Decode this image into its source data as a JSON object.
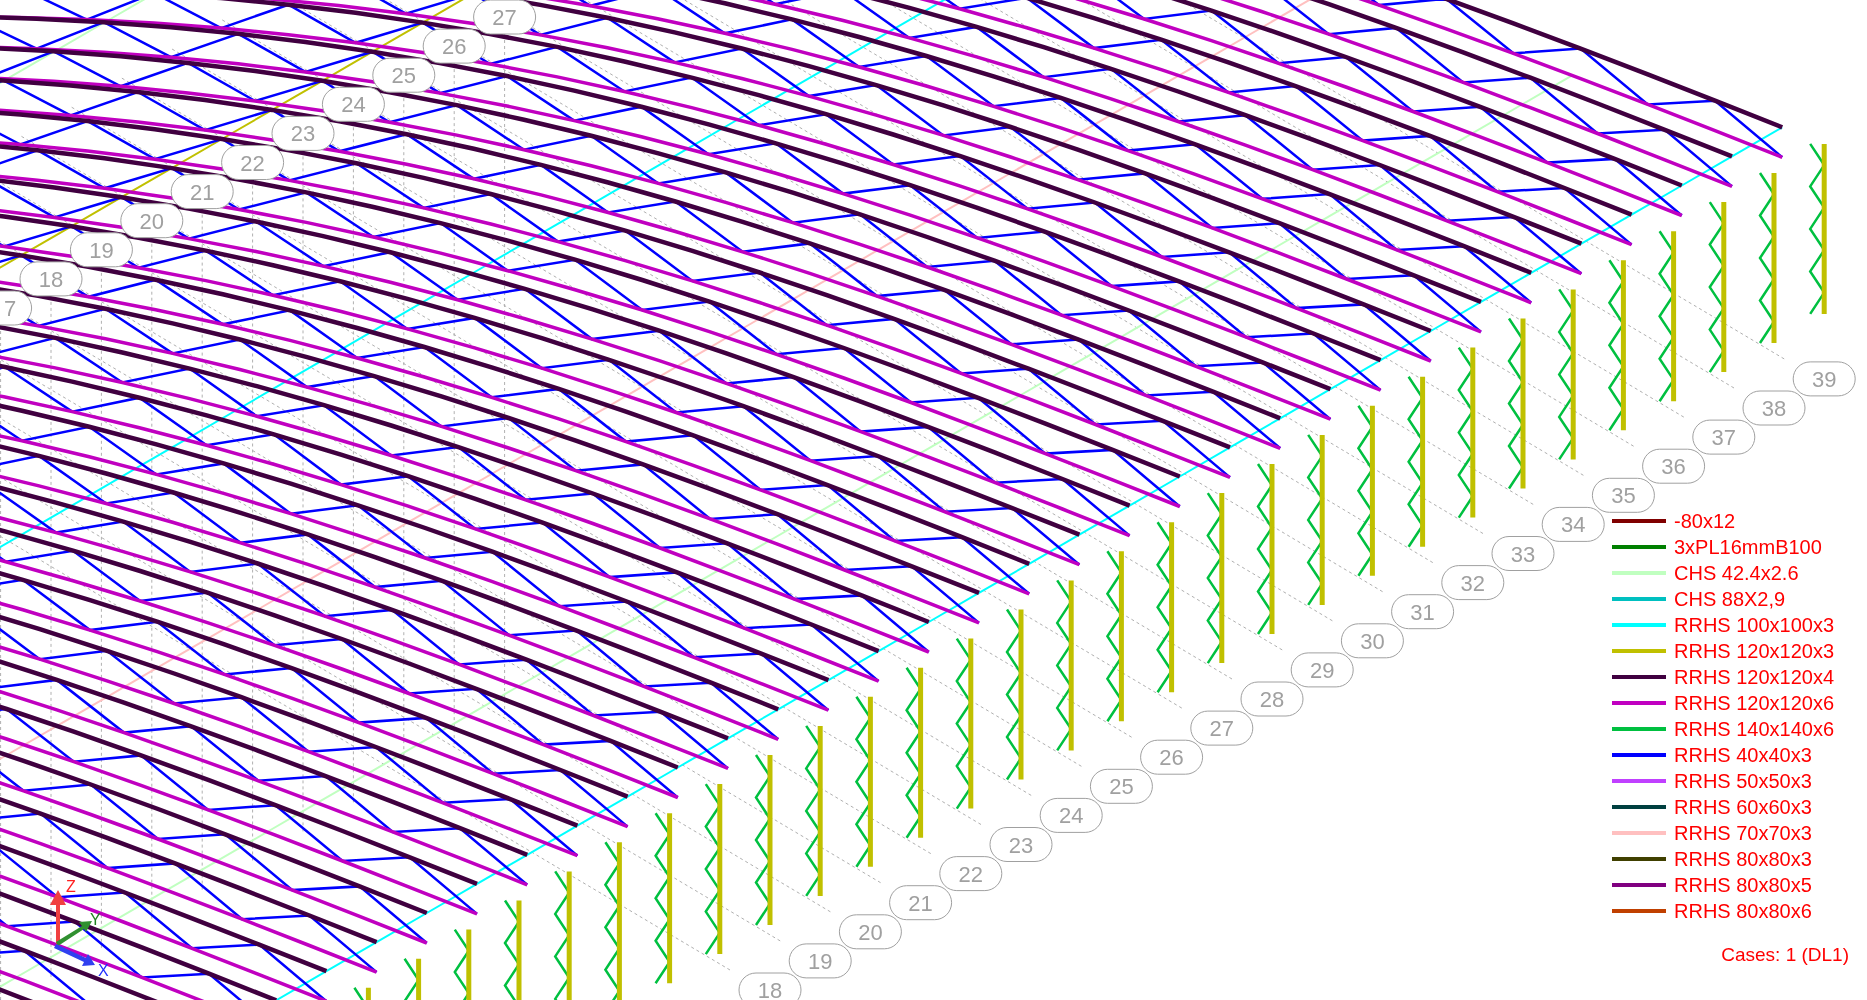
{
  "grid_labels_upper": [
    "7",
    "18",
    "19",
    "20",
    "21",
    "22",
    "23",
    "24",
    "25",
    "26",
    "27"
  ],
  "grid_labels_lower": [
    "18",
    "19",
    "20",
    "21",
    "22",
    "23",
    "24",
    "25",
    "26",
    "27",
    "28",
    "29",
    "30",
    "31",
    "32",
    "33",
    "34",
    "35",
    "36",
    "37",
    "38",
    "39"
  ],
  "legend": [
    {
      "label": "-80x12",
      "color": "#800000"
    },
    {
      "label": "3xPL16mmB100",
      "color": "#008000"
    },
    {
      "label": "CHS 42.4x2.6",
      "color": "#c0ffc0"
    },
    {
      "label": "CHS 88X2,9",
      "color": "#00c0c0"
    },
    {
      "label": "RRHS 100x100x3",
      "color": "#00ffff"
    },
    {
      "label": "RRHS 120x120x3",
      "color": "#c0c000"
    },
    {
      "label": "RRHS 120x120x4",
      "color": "#400040"
    },
    {
      "label": "RRHS 120x120x6",
      "color": "#c000c0"
    },
    {
      "label": "RRHS 140x140x6",
      "color": "#00c040"
    },
    {
      "label": "RRHS 40x40x3",
      "color": "#0000ff"
    },
    {
      "label": "RRHS 50x50x3",
      "color": "#c040ff"
    },
    {
      "label": "RRHS 60x60x3",
      "color": "#004040"
    },
    {
      "label": "RRHS 70x70x3",
      "color": "#ffc0c0"
    },
    {
      "label": "RRHS 80x80x3",
      "color": "#404000"
    },
    {
      "label": "RRHS 80x80x5",
      "color": "#800080"
    },
    {
      "label": "RRHS 80x80x6",
      "color": "#c04000"
    }
  ],
  "cases": "Cases: 1 (DL1)",
  "axes": {
    "z": "Z",
    "y": "Y",
    "x": "X"
  }
}
